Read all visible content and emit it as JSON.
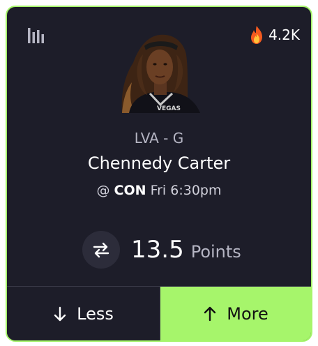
{
  "header": {
    "stats_icon": "bar-chart-icon",
    "trending_icon": "fire-icon",
    "trending_count": "4.2K"
  },
  "player": {
    "team_position": "LVA - G",
    "name": "Chennedy Carter",
    "matchup_prefix": "@",
    "opponent": "CON",
    "game_time": "Fri 6:30pm"
  },
  "projection": {
    "swap_icon": "swap-arrows-icon",
    "value": "13.5",
    "stat": "Points"
  },
  "actions": {
    "less_icon": "arrow-down-icon",
    "less_label": "Less",
    "more_icon": "arrow-up-icon",
    "more_label": "More"
  },
  "colors": {
    "accent": "#a6f56b",
    "card_bg": "#1d1d29"
  }
}
